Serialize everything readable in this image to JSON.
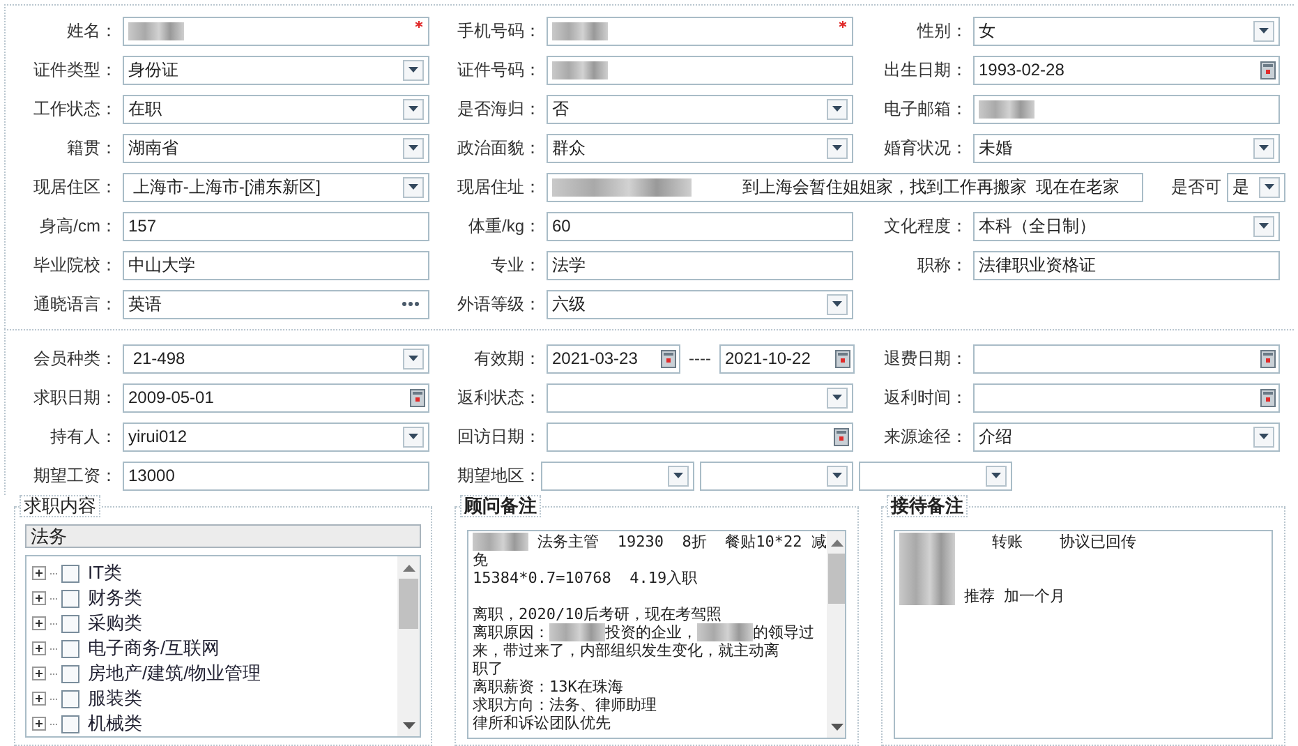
{
  "profile": {
    "rows": [
      {
        "cells": [
          {
            "label": "姓名：",
            "kind": "text",
            "redacted": true,
            "required": true
          },
          {
            "label": "手机号码：",
            "kind": "text",
            "redacted": true,
            "required": true
          },
          {
            "label": "性别：",
            "kind": "select",
            "value": "女"
          }
        ]
      },
      {
        "cells": [
          {
            "label": "证件类型：",
            "kind": "select",
            "value": "身份证"
          },
          {
            "label": "证件号码：",
            "kind": "text",
            "redacted": true
          },
          {
            "label": "出生日期：",
            "kind": "date",
            "value": "1993-02-28"
          }
        ]
      },
      {
        "cells": [
          {
            "label": "工作状态：",
            "kind": "select",
            "value": "在职"
          },
          {
            "label": "是否海归：",
            "kind": "select",
            "value": "否"
          },
          {
            "label": "电子邮箱：",
            "kind": "text",
            "redacted": true
          }
        ]
      },
      {
        "cells": [
          {
            "label": "籍贯：",
            "kind": "select",
            "value": "湖南省"
          },
          {
            "label": "政治面貌：",
            "kind": "select",
            "value": "群众"
          },
          {
            "label": "婚育状况：",
            "kind": "select",
            "value": "未婚"
          }
        ]
      },
      {
        "cells": [
          {
            "label": "现居住区：",
            "kind": "select",
            "value": " 上海市-上海市-[浦东新区]"
          },
          {
            "label": "现居住址：",
            "kind": "wide_text",
            "redacted": true,
            "value": "到上海会暂住姐姐家，找到工作再搬家  现在在老家"
          },
          {
            "label": "是否可",
            "kind": "mini_select",
            "value": "是"
          }
        ]
      },
      {
        "cells": [
          {
            "label": "身高/cm：",
            "kind": "text",
            "value": "157"
          },
          {
            "label": "体重/kg：",
            "kind": "text",
            "value": "60"
          },
          {
            "label": "文化程度：",
            "kind": "select",
            "value": "本科（全日制）"
          }
        ]
      },
      {
        "cells": [
          {
            "label": "毕业院校：",
            "kind": "text",
            "value": "中山大学"
          },
          {
            "label": "专业：",
            "kind": "text",
            "value": "法学"
          },
          {
            "label": "职称：",
            "kind": "text",
            "value": "法律职业资格证"
          }
        ]
      },
      {
        "cells": [
          {
            "label": "通晓语言：",
            "kind": "picker",
            "value": "英语"
          },
          {
            "label": "外语等级：",
            "kind": "select",
            "value": "六级"
          }
        ]
      }
    ]
  },
  "membership": {
    "rows": [
      {
        "cells": [
          {
            "label": "会员种类：",
            "kind": "select",
            "value": " 21-498"
          },
          {
            "label": "有效期：",
            "kind": "date_range",
            "from": "2021-03-23",
            "separator": "----",
            "to": "2021-10-22"
          },
          {
            "label": "退费日期：",
            "kind": "date"
          }
        ]
      },
      {
        "cells": [
          {
            "label": "求职日期：",
            "kind": "date",
            "value": "2009-05-01"
          },
          {
            "label": "返利状态：",
            "kind": "select"
          },
          {
            "label": "返利时间：",
            "kind": "date"
          }
        ]
      },
      {
        "cells": [
          {
            "label": "持有人：",
            "kind": "select",
            "value": "yirui012"
          },
          {
            "label": "回访日期：",
            "kind": "date"
          },
          {
            "label": "来源途径：",
            "kind": "select",
            "value": "介绍"
          }
        ]
      },
      {
        "cells": [
          {
            "label": "期望工资：",
            "kind": "text",
            "value": "13000"
          },
          {
            "label": "期望地区：",
            "kind": "region_picker"
          }
        ]
      }
    ]
  },
  "job_panel": {
    "legend": "求职内容",
    "search_value": "法务",
    "tree": [
      {
        "label": "IT类",
        "checked": false,
        "expanded": false
      },
      {
        "label": "财务类",
        "checked": false,
        "expanded": false
      },
      {
        "label": "采购类",
        "checked": false,
        "expanded": false
      },
      {
        "label": "电子商务/互联网",
        "checked": false,
        "expanded": false
      },
      {
        "label": "房地产/建筑/物业管理",
        "checked": false,
        "expanded": false
      },
      {
        "label": "服装类",
        "checked": false,
        "expanded": false
      },
      {
        "label": "机械类",
        "checked": false,
        "expanded": false
      }
    ]
  },
  "consultant_notes": {
    "legend": "顾问备注",
    "scrollbar": true,
    "lines": [
      [
        {
          "kind": "redacted"
        },
        {
          "kind": "text",
          "text": " 法务主管  19230  8折  餐贴10*22 减"
        }
      ],
      [
        {
          "kind": "text",
          "text": "免"
        }
      ],
      [
        {
          "kind": "text",
          "text": "15384*0.7=10768  4.19入职"
        }
      ],
      [
        {
          "kind": "blank"
        }
      ],
      [
        {
          "kind": "text",
          "text": "离职，2020/10后考研，现在考驾照"
        }
      ],
      [
        {
          "kind": "text",
          "text": "离职原因："
        },
        {
          "kind": "redacted"
        },
        {
          "kind": "text",
          "text": "投资的企业，"
        },
        {
          "kind": "redacted"
        },
        {
          "kind": "text",
          "text": "的领导过"
        }
      ],
      [
        {
          "kind": "text",
          "text": "来，带过来了，内部组织发生变化，就主动离"
        }
      ],
      [
        {
          "kind": "text",
          "text": "职了"
        }
      ],
      [
        {
          "kind": "text",
          "text": "离职薪资：13K在珠海"
        }
      ],
      [
        {
          "kind": "text",
          "text": "求职方向：法务、律师助理"
        }
      ],
      [
        {
          "kind": "text",
          "text": "律所和诉讼团队优先"
        }
      ]
    ]
  },
  "reception_notes": {
    "legend": "接待备注",
    "scrollbar": false,
    "lines": [
      [
        {
          "kind": "redacted"
        },
        {
          "kind": "text",
          "text": "    转账    协议已回传"
        }
      ],
      [
        {
          "kind": "redacted"
        }
      ],
      [
        {
          "kind": "redacted"
        }
      ],
      [
        {
          "kind": "redacted"
        },
        {
          "kind": "text",
          "text": " 推荐 加一个月"
        }
      ]
    ]
  }
}
